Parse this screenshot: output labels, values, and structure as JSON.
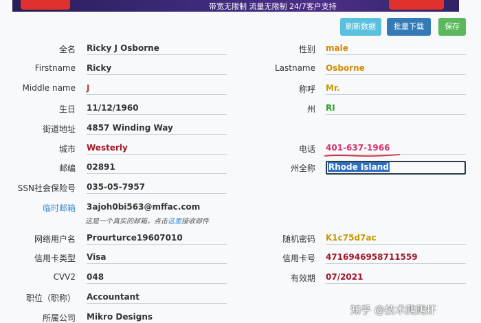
{
  "banner": {
    "text": "带宽无限制    流量无限制    24/7客户支持"
  },
  "toolbar": {
    "refresh_label": "刷新数据",
    "download_label": "批量下载",
    "save_label": "保存"
  },
  "fields_left": [
    {
      "label": "全名",
      "value": "Ricky J Osborne",
      "color": "#333333"
    },
    {
      "label": "Firstname",
      "value": "Ricky",
      "color": "#333333"
    },
    {
      "label": "Middle name",
      "value": "J",
      "color": "#c0392b"
    },
    {
      "label": "生日",
      "value": "11/12/1960",
      "color": "#333333"
    },
    {
      "label": "街道地址",
      "value": "4857 Winding Way",
      "color": "#333333"
    },
    {
      "label": "城市",
      "value": "Westerly",
      "color": "#a31626"
    },
    {
      "label": "邮编",
      "value": "02891",
      "color": "#333333"
    },
    {
      "label": "SSN社会保险号",
      "value": "035-05-7957",
      "color": "#333333"
    },
    {
      "label": "临时邮箱",
      "value": "3ajoh0bi563@mffac.com",
      "color": "#333333"
    },
    {
      "label": "网络用户名",
      "value": "Prourturce19607010",
      "color": "#333333"
    },
    {
      "label": "信用卡类型",
      "value": "Visa",
      "color": "#333333"
    },
    {
      "label": "CVV2",
      "value": "048",
      "color": "#333333"
    },
    {
      "label": "职位（职称）",
      "value": "Accountant",
      "color": "#333333"
    },
    {
      "label": "所属公司",
      "value": "Mikro Designs",
      "color": "#333333"
    }
  ],
  "fields_right": [
    {
      "label": "性别",
      "value": "male",
      "color": "#d68a00"
    },
    {
      "label": "Lastname",
      "value": "Osborne",
      "color": "#d68a00"
    },
    {
      "label": "称呼",
      "value": "Mr.",
      "color": "#c79a00"
    },
    {
      "label": "州",
      "value": "RI",
      "color": "#27a327"
    },
    {
      "label": "电话",
      "value": "401-637-1966",
      "color": "#d6336c"
    },
    {
      "label": "州全称",
      "value": "Rhode Island",
      "color": "#ffffff"
    },
    {
      "label": "随机密码",
      "value": "K1c75d7ac",
      "color": "#c79a00"
    },
    {
      "label": "信用卡号",
      "value": "4716946958711559",
      "color": "#a31626"
    },
    {
      "label": "有效期",
      "value": "07/2021",
      "color": "#a31626"
    }
  ],
  "email_note": {
    "prefix": "这是一个真实的邮箱，点击",
    "link": "这里",
    "suffix": "接收邮件"
  },
  "watermark": "知乎 @技术爬爬虾"
}
